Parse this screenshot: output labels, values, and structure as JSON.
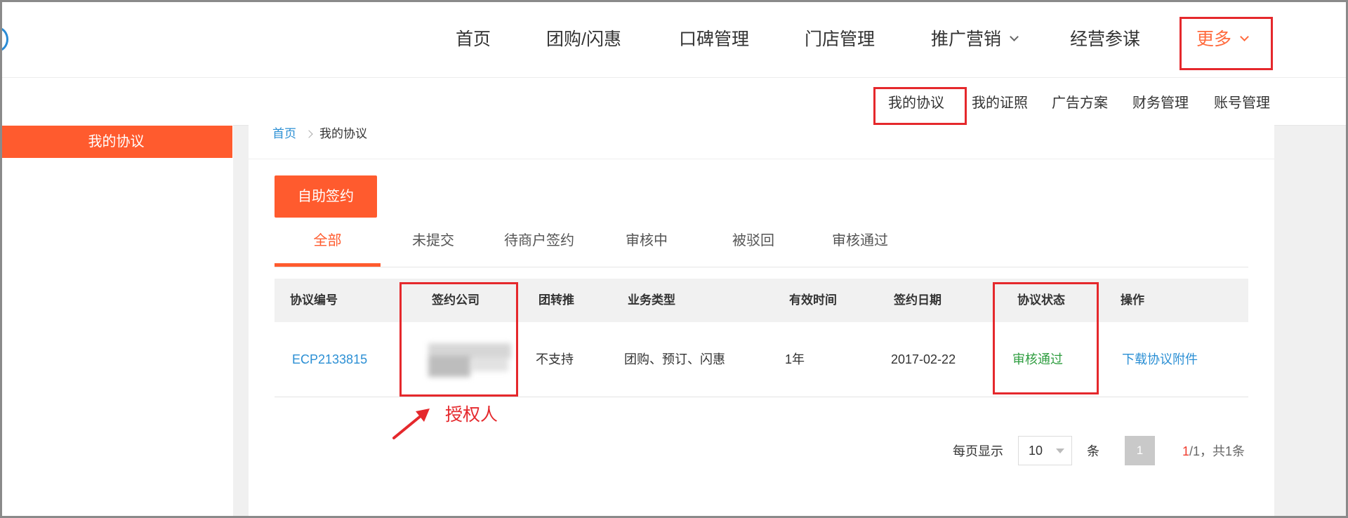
{
  "colors": {
    "accent": "#ff5b2e",
    "nav_active": "#ff6a3d",
    "link": "#2b8fd4",
    "success": "#2e9d3f",
    "annotation": "#e5282c",
    "page_bg": "#f0f0f0",
    "pager_current": "#f03c2e"
  },
  "icons": {
    "logo": "brand-logo-icon",
    "dropdown": "chevron-down-icon",
    "breadcrumb_separator": "chevron-right-icon",
    "select_arrow": "caret-down-icon"
  },
  "top_nav": {
    "items": [
      {
        "label": "首页"
      },
      {
        "label": "团购/闪惠"
      },
      {
        "label": "口碑管理"
      },
      {
        "label": "门店管理"
      },
      {
        "label": "推广营销",
        "dropdown": true
      },
      {
        "label": "经营参谋"
      },
      {
        "label": "更多",
        "dropdown": true,
        "active": true
      }
    ]
  },
  "sub_nav": {
    "items": [
      {
        "label": "我的协议",
        "active": true
      },
      {
        "label": "我的证照"
      },
      {
        "label": "广告方案"
      },
      {
        "label": "财务管理"
      },
      {
        "label": "账号管理"
      }
    ]
  },
  "sidebar": {
    "items": [
      {
        "label": "我的协议",
        "active": true
      }
    ]
  },
  "breadcrumb": {
    "home": "首页",
    "current": "我的协议"
  },
  "toolbar": {
    "self_sign_label": "自助签约"
  },
  "tabs": {
    "active_index": 0,
    "items": [
      {
        "label": "全部"
      },
      {
        "label": "未提交"
      },
      {
        "label": "待商户签约"
      },
      {
        "label": "审核中"
      },
      {
        "label": "被驳回"
      },
      {
        "label": "审核通过"
      }
    ]
  },
  "table": {
    "headers": [
      "协议编号",
      "签约公司",
      "团转推",
      "业务类型",
      "有效时间",
      "签约日期",
      "协议状态",
      "操作"
    ],
    "rows": [
      {
        "agreement_no": "ECP2133815",
        "transfer": "不支持",
        "business_type": "团购、预订、闪惠",
        "validity": "1年",
        "sign_date": "2017-02-22",
        "status": "审核通过",
        "action": "下载协议附件"
      }
    ]
  },
  "annotation": {
    "label": "授权人"
  },
  "pagination": {
    "per_page_label": "每页显示",
    "per_page_value": "10",
    "per_page_unit": "条",
    "current_page": "1",
    "summary_current": "1",
    "summary_rest": "/1，共1条"
  }
}
